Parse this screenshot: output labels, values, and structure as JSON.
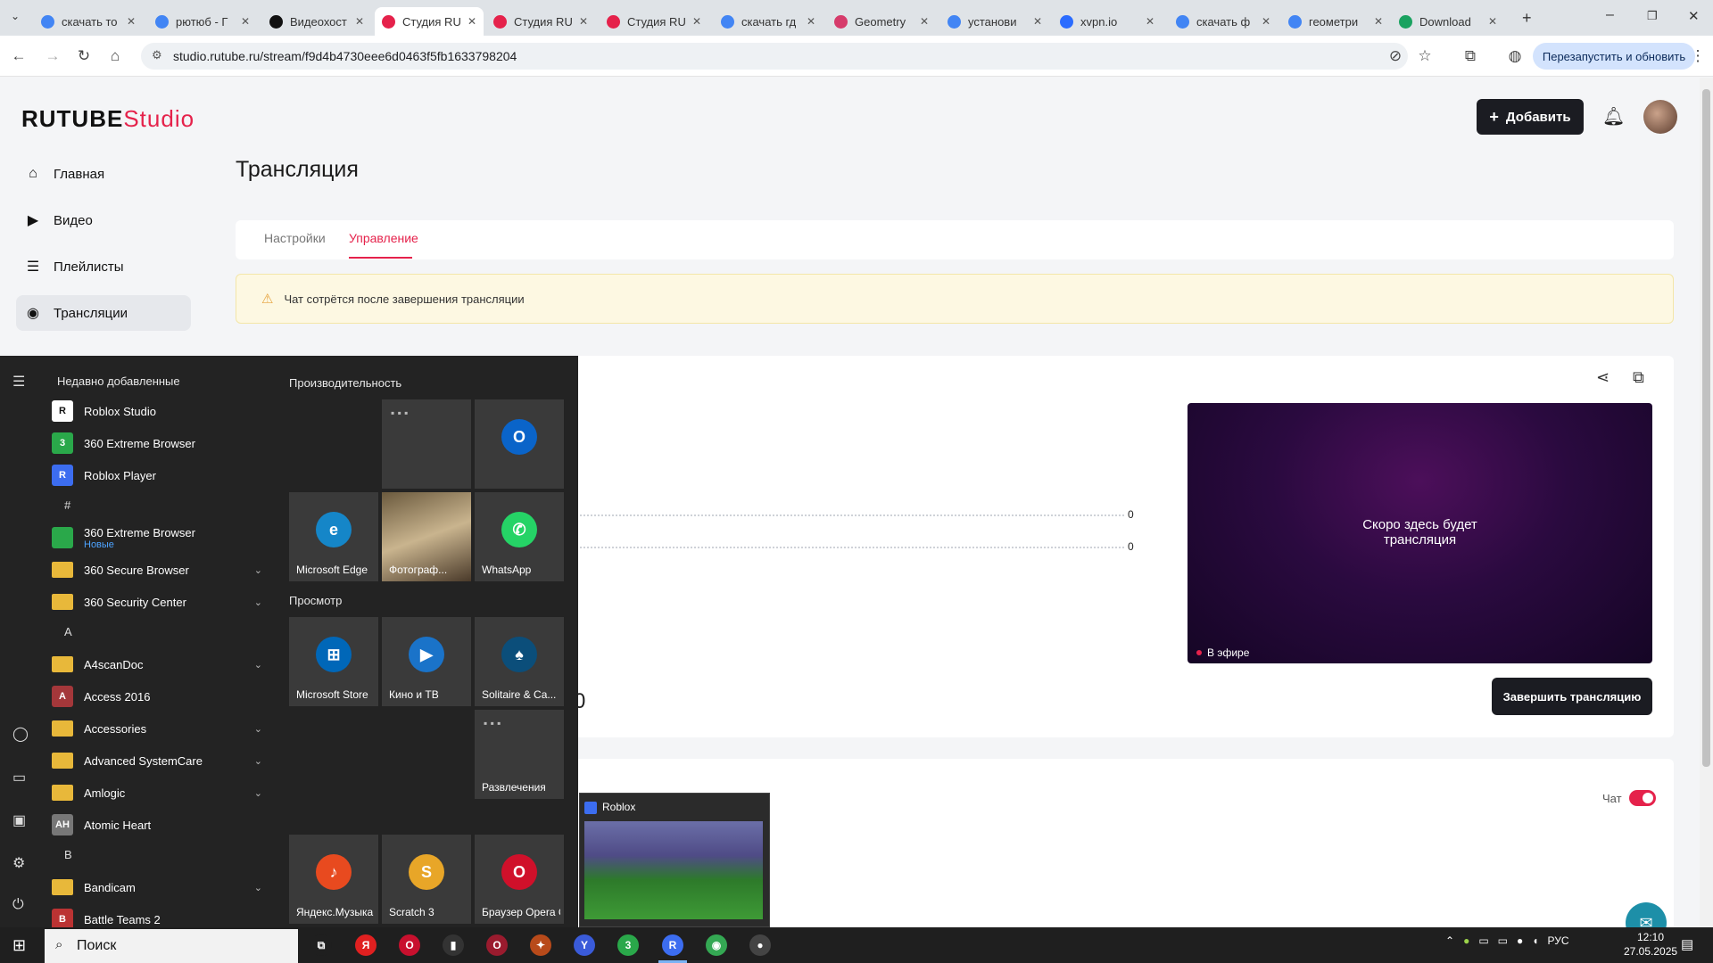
{
  "browser": {
    "tabs": [
      {
        "title": "скачать то",
        "color": "#4285f4"
      },
      {
        "title": "рютюб - Г",
        "color": "#4285f4"
      },
      {
        "title": "Видеохост",
        "color": "#111111"
      },
      {
        "title": "Студия RU",
        "color": "#e5224b"
      },
      {
        "title": "Студия RU",
        "color": "#e5224b"
      },
      {
        "title": "Студия RU",
        "color": "#e5224b"
      },
      {
        "title": "скачать гд",
        "color": "#4285f4"
      },
      {
        "title": "Geometry",
        "color": "#d63b6b"
      },
      {
        "title": "установи",
        "color": "#4285f4"
      },
      {
        "title": "xvpn.io",
        "color": "#2b6cff"
      },
      {
        "title": "скачать ф",
        "color": "#4285f4"
      },
      {
        "title": "геометри",
        "color": "#4285f4"
      },
      {
        "title": "Download",
        "color": "#1aa260"
      }
    ],
    "url": "studio.rutube.ru/stream/f9d4b4730eee6d0463f5fb1633798204",
    "relaunch_label": "Перезапустить и обновить"
  },
  "app": {
    "logo_main": "RUTUBE",
    "logo_studio": "Studio",
    "add_button": "Добавить",
    "nav": [
      {
        "label": "Главная",
        "icon": "home-icon"
      },
      {
        "label": "Видео",
        "icon": "video-icon"
      },
      {
        "label": "Плейлисты",
        "icon": "playlist-icon"
      },
      {
        "label": "Трансляции",
        "icon": "broadcast-icon"
      }
    ],
    "page_title": "Трансляция",
    "tabs": [
      "Настройки",
      "Управление"
    ],
    "active_tab": "Управление",
    "warning": "Чат сотрётся после завершения трансляции",
    "stat_values": [
      "0",
      "0"
    ],
    "big_value": "0",
    "player_text_line1": "Скоро здесь будет",
    "player_text_line2": "трансляция",
    "live_label": "В эфире",
    "end_button": "Завершить трансляцию",
    "chat_label": "Чат",
    "chat_enabled": true,
    "accent_color": "#e5224b"
  },
  "start_menu": {
    "recent_heading": "Недавно добавленные",
    "recent": [
      {
        "label": "Roblox Studio",
        "color": "#ffffff",
        "glyph": "R"
      },
      {
        "label": "360 Extreme Browser",
        "color": "#2aa84a",
        "glyph": "3"
      },
      {
        "label": "Roblox Player",
        "color": "#3c6df0",
        "glyph": "R"
      }
    ],
    "groups": [
      {
        "letter": "#",
        "items": [
          {
            "label": "360 Extreme Browser",
            "sub": "Новые",
            "color": "#2aa84a",
            "folder": false
          },
          {
            "label": "360 Secure Browser",
            "folder": true
          },
          {
            "label": "360 Security Center",
            "folder": true
          }
        ]
      },
      {
        "letter": "A",
        "items": [
          {
            "label": "A4scanDoc",
            "folder": true
          },
          {
            "label": "Access 2016",
            "color": "#a4373a",
            "folder": false,
            "glyph": "A"
          },
          {
            "label": "Accessories",
            "folder": true
          },
          {
            "label": "Advanced SystemCare",
            "folder": true
          },
          {
            "label": "Amlogic",
            "folder": true
          },
          {
            "label": "Atomic Heart",
            "color": "#777777",
            "folder": false,
            "glyph": "AH"
          }
        ]
      },
      {
        "letter": "B",
        "items": [
          {
            "label": "Bandicam",
            "folder": true
          },
          {
            "label": "Battle Teams 2",
            "color": "#b33",
            "folder": false,
            "glyph": "B"
          }
        ]
      }
    ],
    "tiles_heading_1": "Производительность",
    "tiles_heading_2": "Просмотр",
    "tiles": [
      {
        "label": "",
        "icon": "office-group-icon"
      },
      {
        "label": "",
        "icon": "outlook-icon",
        "glyph": "O",
        "color": "#0a64c9"
      },
      {
        "label": "Microsoft Edge",
        "icon": "edge-icon",
        "glyph": "e",
        "color": "#1586c8"
      },
      {
        "label": "Фотограф...",
        "icon": "photos-icon"
      },
      {
        "label": "WhatsApp",
        "icon": "whatsapp-icon",
        "glyph": "✆",
        "color": "#25d366"
      },
      {
        "label": "Microsoft Store",
        "icon": "store-icon",
        "glyph": "⊞",
        "color": "#0067b8"
      },
      {
        "label": "Кино и ТВ",
        "icon": "movies-icon",
        "glyph": "▶",
        "color": "#1a73c9"
      },
      {
        "label": "Solitaire & Ca...",
        "icon": "solitaire-icon",
        "glyph": "♠",
        "color": "#0b4e7a"
      },
      {
        "label": "Развлечения",
        "icon": "entertainment-group-icon"
      },
      {
        "label": "Яндекс.Музыка",
        "icon": "yandex-music-icon",
        "glyph": "♪",
        "color": "#e84a1f"
      },
      {
        "label": "Scratch 3",
        "icon": "scratch-icon",
        "glyph": "S",
        "color": "#e8a628"
      },
      {
        "label": "Браузер Opera GX",
        "icon": "opera-gx-icon",
        "glyph": "O",
        "color": "#d0102a"
      }
    ]
  },
  "preview": {
    "title": "Roblox"
  },
  "taskbar": {
    "search_placeholder": "Поиск",
    "tray_lang": "РУС",
    "time": "12:10",
    "date": "27.05.2025",
    "apps": [
      {
        "icon": "task-view-icon",
        "glyph": "⧉",
        "color": "#1f1f1f"
      },
      {
        "icon": "yandex-icon",
        "glyph": "Я",
        "color": "#e02020"
      },
      {
        "icon": "opera-icon",
        "glyph": "O",
        "color": "#c8102e"
      },
      {
        "icon": "app-icon",
        "glyph": "▮",
        "color": "#333333"
      },
      {
        "icon": "opera-gx-taskbar-icon",
        "glyph": "O",
        "color": "#9a1b2e"
      },
      {
        "icon": "game-icon",
        "glyph": "✦",
        "color": "#b84a1a"
      },
      {
        "icon": "yandex-browser-icon",
        "glyph": "Y",
        "color": "#3a5bd9"
      },
      {
        "icon": "360-browser-icon",
        "glyph": "3",
        "color": "#2aa84a"
      },
      {
        "icon": "roblox-icon",
        "glyph": "R",
        "color": "#3c6df0"
      },
      {
        "icon": "chrome-icon",
        "glyph": "◉",
        "color": "#34a853"
      },
      {
        "icon": "obs-icon",
        "glyph": "●",
        "color": "#444444"
      }
    ]
  }
}
